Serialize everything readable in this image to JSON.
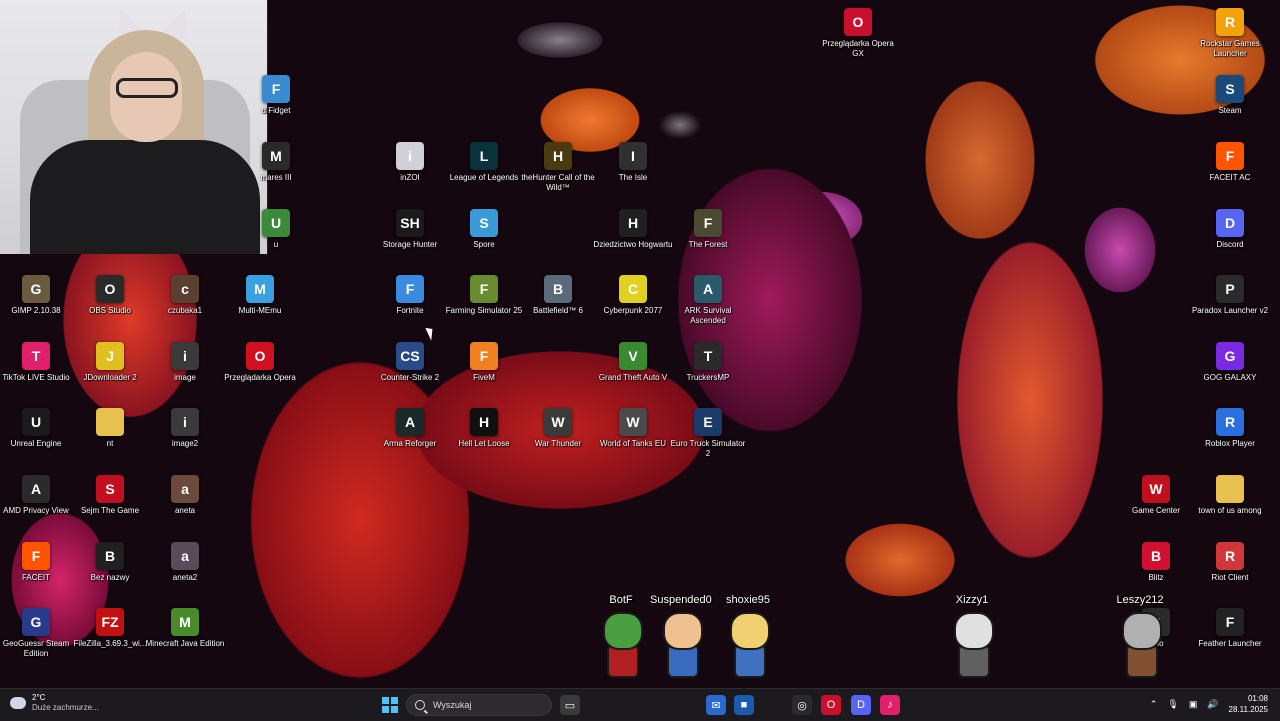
{
  "desktop_icons": [
    {
      "id": "opera-gx",
      "label": "Przeglądarka Opera GX",
      "glyph": "O",
      "color": "#c8102e",
      "icon": "opera-gx-icon"
    },
    {
      "id": "rockstar",
      "label": "Rockstar Games Launcher",
      "glyph": "R",
      "color": "#f4a20c",
      "icon": "rockstar-icon"
    },
    {
      "id": "steam",
      "label": "Steam",
      "glyph": "S",
      "color": "#1b4a7a",
      "icon": "steam-icon"
    },
    {
      "id": "faceit-ac",
      "label": "FACEIT AC",
      "glyph": "F",
      "color": "#ff5500",
      "icon": "faceit-ac-icon"
    },
    {
      "id": "discord",
      "label": "Discord",
      "glyph": "D",
      "color": "#5865f2",
      "icon": "discord-icon"
    },
    {
      "id": "paradox",
      "label": "Paradox Launcher v2",
      "glyph": "P",
      "color": "#2a2a2a",
      "icon": "paradox-icon"
    },
    {
      "id": "gog",
      "label": "GOG GALAXY",
      "glyph": "G",
      "color": "#7a2ae0",
      "icon": "gog-icon"
    },
    {
      "id": "roblox",
      "label": "Roblox Player",
      "glyph": "R",
      "color": "#2a6fe0",
      "icon": "roblox-icon"
    },
    {
      "id": "game-center",
      "label": "Game Center",
      "glyph": "W",
      "color": "#c01020",
      "icon": "game-center-icon"
    },
    {
      "id": "town-of-us",
      "label": "town of us among",
      "glyph": "",
      "color": "#e8c050",
      "icon": "folder-icon"
    },
    {
      "id": "blitz",
      "label": "Blitz",
      "glyph": "B",
      "color": "#d01030",
      "icon": "blitz-icon"
    },
    {
      "id": "riot",
      "label": "Riot Client",
      "glyph": "R",
      "color": "#d13639",
      "icon": "riot-icon"
    },
    {
      "id": "feather",
      "label": "Feather Launcher",
      "glyph": "F",
      "color": "#222",
      "icon": "feather-icon"
    },
    {
      "id": "inzoi",
      "label": "inZOI",
      "glyph": "i",
      "color": "#d0d0d8",
      "icon": "inzoi-icon"
    },
    {
      "id": "lol",
      "label": "League of Legends",
      "glyph": "L",
      "color": "#0a323c",
      "icon": "league-icon"
    },
    {
      "id": "thehunter",
      "label": "theHunter Call of the Wild™",
      "glyph": "H",
      "color": "#4a3a10",
      "icon": "thehunter-icon"
    },
    {
      "id": "theisle",
      "label": "The Isle",
      "glyph": "I",
      "color": "#303030",
      "icon": "theisle-icon"
    },
    {
      "id": "storage-hunter",
      "label": "Storage Hunter",
      "glyph": "SH",
      "color": "#1a1a1a",
      "icon": "storage-hunter-icon"
    },
    {
      "id": "spore",
      "label": "Spore",
      "glyph": "S",
      "color": "#3a9ad8",
      "icon": "spore-icon"
    },
    {
      "id": "hogwarts",
      "label": "Dziedzictwo Hogwartu",
      "glyph": "H",
      "color": "#202020",
      "icon": "hogwarts-icon"
    },
    {
      "id": "theforest",
      "label": "The Forest",
      "glyph": "F",
      "color": "#4a4a30",
      "icon": "theforest-icon"
    },
    {
      "id": "fortnite",
      "label": "Fortnite",
      "glyph": "F",
      "color": "#3a8ae0",
      "icon": "fortnite-icon"
    },
    {
      "id": "farming",
      "label": "Farming Simulator 25",
      "glyph": "F",
      "color": "#6a8a30",
      "icon": "farming-icon"
    },
    {
      "id": "battlefield",
      "label": "Battlefield™ 6",
      "glyph": "B",
      "color": "#5a6a7a",
      "icon": "battlefield-icon"
    },
    {
      "id": "cyberpunk",
      "label": "Cyberpunk 2077",
      "glyph": "C",
      "color": "#e0d020",
      "icon": "cyberpunk-icon"
    },
    {
      "id": "ark",
      "label": "ARK Survival Ascended",
      "glyph": "A",
      "color": "#2a5a6a",
      "icon": "ark-icon"
    },
    {
      "id": "cs2",
      "label": "Counter-Strike 2",
      "glyph": "CS",
      "color": "#2a4a8a",
      "icon": "cs2-icon"
    },
    {
      "id": "fivem",
      "label": "FiveM",
      "glyph": "F",
      "color": "#f08020",
      "icon": "fivem-icon"
    },
    {
      "id": "gtav",
      "label": "Grand Theft Auto V",
      "glyph": "V",
      "color": "#3a8a30",
      "icon": "gtav-icon"
    },
    {
      "id": "truckersmp",
      "label": "TruckersMP",
      "glyph": "T",
      "color": "#2a2a2a",
      "icon": "truckersmp-icon"
    },
    {
      "id": "arma",
      "label": "Arma Reforger",
      "glyph": "A",
      "color": "#1a2a2a",
      "icon": "arma-icon"
    },
    {
      "id": "hellletloose",
      "label": "Hell Let Loose",
      "glyph": "H",
      "color": "#101010",
      "icon": "hellletloose-icon"
    },
    {
      "id": "warthunder",
      "label": "War Thunder",
      "glyph": "W",
      "color": "#3a3a3a",
      "icon": "warthunder-icon"
    },
    {
      "id": "wot",
      "label": "World of Tanks EU",
      "glyph": "W",
      "color": "#4a4a4a",
      "icon": "wot-icon"
    },
    {
      "id": "ets2",
      "label": "Euro Truck Simulator 2",
      "glyph": "E",
      "color": "#1a3a6a",
      "icon": "ets2-icon"
    },
    {
      "id": "fidget",
      "label": "d Fidget",
      "glyph": "F",
      "color": "#3a8ad0",
      "icon": "fidget-icon"
    },
    {
      "id": "mares",
      "label": "mares III",
      "glyph": "M",
      "color": "#2a2a2a",
      "icon": "mares-icon"
    },
    {
      "id": "u",
      "label": "u",
      "glyph": "U",
      "color": "#3a8a3a",
      "icon": "app-icon"
    },
    {
      "id": "gimp",
      "label": "GIMP 2.10.38",
      "glyph": "G",
      "color": "#6a5a40",
      "icon": "gimp-icon"
    },
    {
      "id": "obs",
      "label": "OBS Studio",
      "glyph": "O",
      "color": "#2a2a2a",
      "icon": "obs-icon"
    },
    {
      "id": "czubaka1",
      "label": "czubaka1",
      "glyph": "c",
      "color": "#5a4030",
      "icon": "image-icon"
    },
    {
      "id": "multimemu",
      "label": "Multi-MEmu",
      "glyph": "M",
      "color": "#3aa0e0",
      "icon": "memu-icon"
    },
    {
      "id": "tiktok-live",
      "label": "TikTok LIVE Studio",
      "glyph": "T",
      "color": "#e0206a",
      "icon": "tiktok-icon"
    },
    {
      "id": "jdownloader",
      "label": "JDownloader 2",
      "glyph": "J",
      "color": "#e0c020",
      "icon": "jdownloader-icon"
    },
    {
      "id": "image",
      "label": "image",
      "glyph": "i",
      "color": "#3a3a3a",
      "icon": "image-icon"
    },
    {
      "id": "opera",
      "label": "Przeglądarka Opera",
      "glyph": "O",
      "color": "#d01020",
      "icon": "opera-icon"
    },
    {
      "id": "unreal",
      "label": "Unreal Engine",
      "glyph": "U",
      "color": "#1a1a1a",
      "icon": "unreal-icon"
    },
    {
      "id": "nt",
      "label": "nt",
      "glyph": "",
      "color": "#e8c050",
      "icon": "folder-icon"
    },
    {
      "id": "image2",
      "label": "image2",
      "glyph": "i",
      "color": "#3a3a3a",
      "icon": "image-icon"
    },
    {
      "id": "amd",
      "label": "AMD Privacy View",
      "glyph": "A",
      "color": "#2a2a2a",
      "icon": "amd-icon"
    },
    {
      "id": "sejm",
      "label": "Sejm The Game",
      "glyph": "S",
      "color": "#c01020",
      "icon": "sejm-icon"
    },
    {
      "id": "aneta",
      "label": "aneta",
      "glyph": "a",
      "color": "#6a4a3a",
      "icon": "image-icon"
    },
    {
      "id": "faceit",
      "label": "FACEIT",
      "glyph": "F",
      "color": "#ff5500",
      "icon": "faceit-icon"
    },
    {
      "id": "beznazwy",
      "label": "Bez nazwy",
      "glyph": "B",
      "color": "#202020",
      "icon": "file-icon"
    },
    {
      "id": "aneta2",
      "label": "aneta2",
      "glyph": "a",
      "color": "#5a4a5a",
      "icon": "image-icon"
    },
    {
      "id": "geoguessr",
      "label": "GeoGuessr Steam Edition",
      "glyph": "G",
      "color": "#2a3a8a",
      "icon": "geoguessr-icon"
    },
    {
      "id": "filezilla",
      "label": "FileZilla_3.69.3_wi...",
      "glyph": "FZ",
      "color": "#c01010",
      "icon": "filezilla-icon"
    },
    {
      "id": "minecraft",
      "label": "Minecraft Java Edition",
      "glyph": "M",
      "color": "#4a8a2a",
      "icon": "minecraft-icon"
    },
    {
      "id": "studio",
      "label": "udio",
      "glyph": "S",
      "color": "#2a2a2a",
      "icon": "app-icon"
    }
  ],
  "viewers": [
    {
      "name": "BotF",
      "head": "#4aa040",
      "body": "#b02020"
    },
    {
      "name": "Suspended0",
      "head": "#f0c090",
      "body": "#3a6ac0"
    },
    {
      "name": "shoxie95",
      "head": "#f0d070",
      "body": "#4070c0"
    },
    {
      "name": "Xizzy1",
      "head": "#e0e0e0",
      "body": "#606060"
    },
    {
      "name": "Leszy212",
      "head": "#b0b0b0",
      "body": "#805030"
    }
  ],
  "taskbar": {
    "weather_temp": "2°C",
    "weather_desc": "Duże zachmurze...",
    "search_placeholder": "Wyszukaj",
    "time": "01:08",
    "date": "28.11.2025"
  }
}
